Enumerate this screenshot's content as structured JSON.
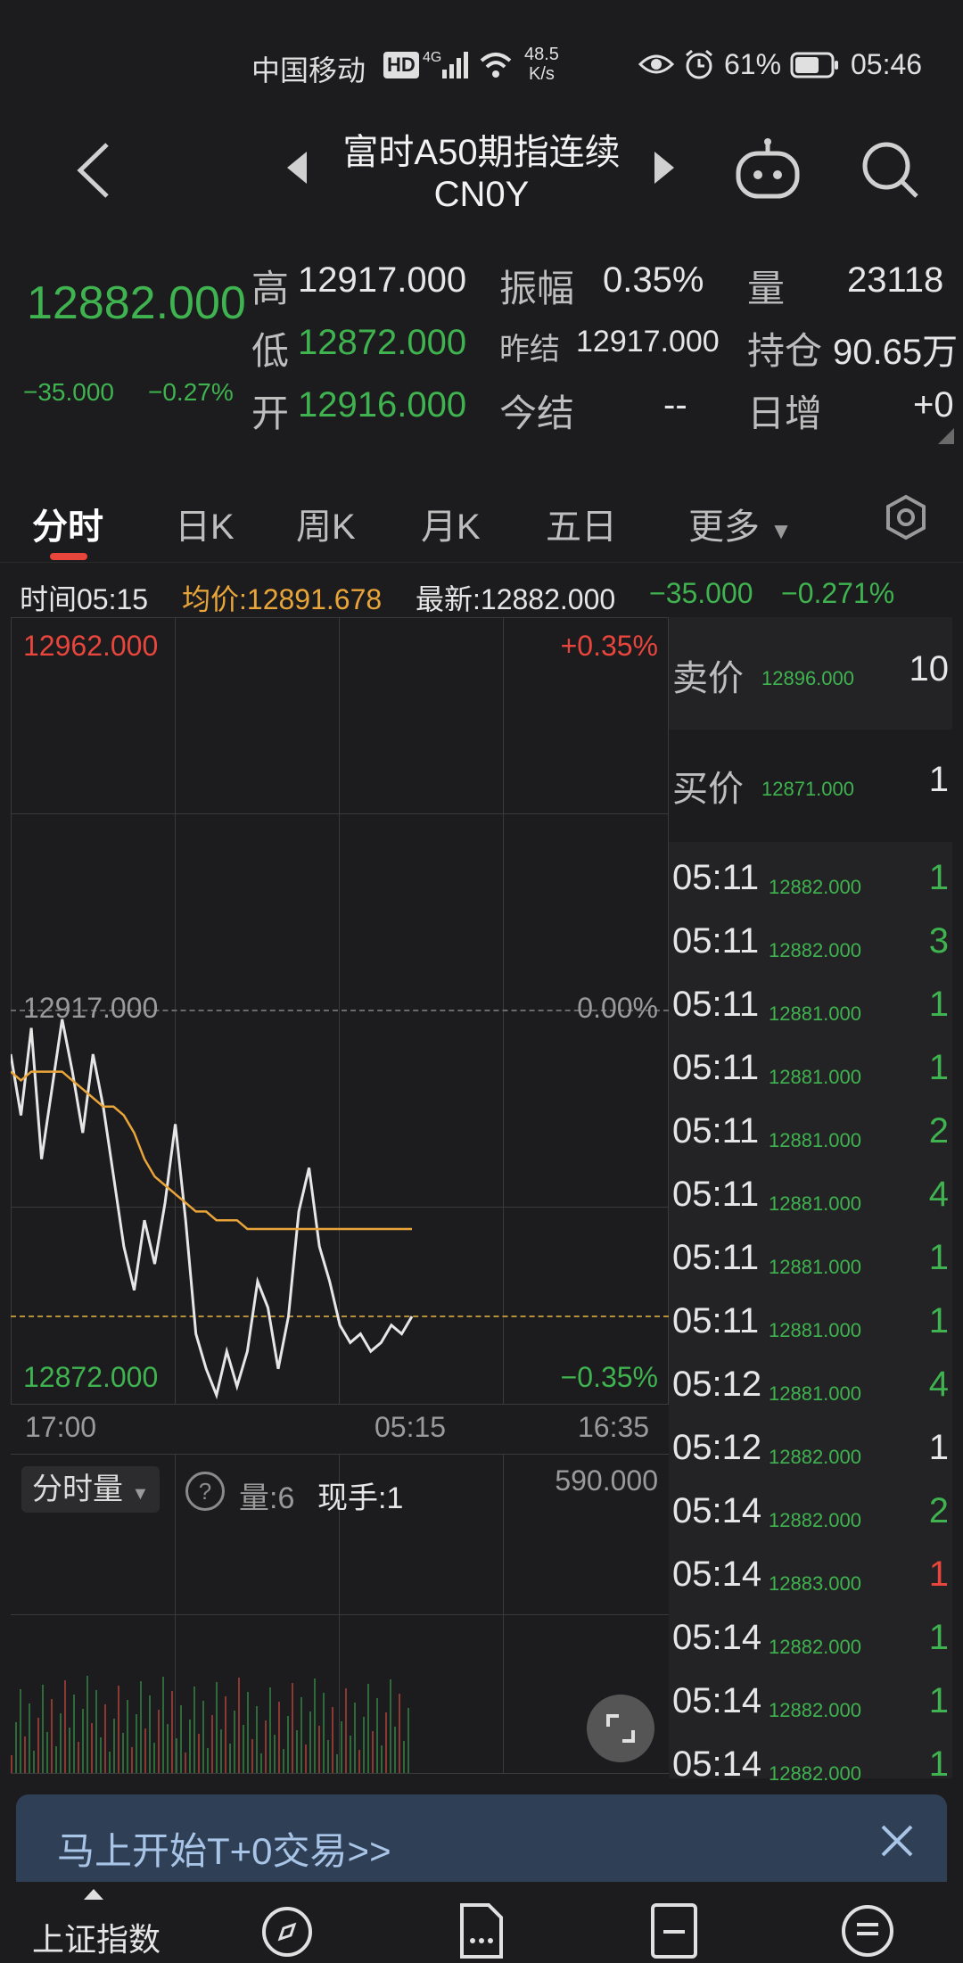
{
  "status_bar": {
    "carrier": "中国移动",
    "hd": "HD",
    "network": "4G",
    "speed_value": "48.5",
    "speed_unit": "K/s",
    "battery": "61%",
    "time": "05:46"
  },
  "header": {
    "title": "富时A50期指连续",
    "code": "CN0Y"
  },
  "quote": {
    "price": "12882.000",
    "change": "−35.000",
    "change_pct": "−0.27%",
    "high_label": "高",
    "high": "12917.000",
    "low_label": "低",
    "low": "12872.000",
    "open_label": "开",
    "open": "12916.000",
    "amplitude_label": "振幅",
    "amplitude": "0.35%",
    "prev_settle_label": "昨结",
    "prev_settle": "12917.000",
    "settle_label": "今结",
    "settle": "--",
    "volume_label": "量",
    "volume": "23118",
    "oi_label": "持仓",
    "oi": "90.65万",
    "daily_inc_label": "日增",
    "daily_inc": "+0"
  },
  "tabs": [
    {
      "label": "分时"
    },
    {
      "label": "日K"
    },
    {
      "label": "周K"
    },
    {
      "label": "月K"
    },
    {
      "label": "五日"
    },
    {
      "label": "更多"
    }
  ],
  "info_line": {
    "time": "时间05:15",
    "avg": "均价:12891.678",
    "latest": "最新:12882.000",
    "change": "−35.000",
    "change_pct": "−0.271%"
  },
  "chart": {
    "top_price": "12962.000",
    "top_pct": "+0.35%",
    "mid_price": "12917.000",
    "mid_pct": "0.00%",
    "bottom_price": "12872.000",
    "bottom_pct": "−0.35%",
    "x_start": "17:00",
    "x_mid": "05:15",
    "x_end": "16:35"
  },
  "chart_data": {
    "type": "line",
    "title": "",
    "xlabel": "",
    "ylabel": "",
    "ylim": [
      12872,
      12962
    ],
    "x_ticks": [
      "17:00",
      "05:15",
      "16:35"
    ],
    "series": [
      {
        "name": "最新",
        "color": "#e6e6e6",
        "values": [
          12912,
          12905,
          12915,
          12900,
          12908,
          12916,
          12910,
          12903,
          12912,
          12906,
          12898,
          12890,
          12885,
          12893,
          12888,
          12895,
          12904,
          12893,
          12880,
          12876,
          12873,
          12878,
          12874,
          12878,
          12886,
          12883,
          12876,
          12882,
          12894,
          12899,
          12890,
          12886,
          12881,
          12879,
          12880,
          12878,
          12879,
          12881,
          12880,
          12882
        ]
      },
      {
        "name": "均价",
        "color": "#e9a53a",
        "values": [
          12910,
          12909,
          12910,
          12910,
          12910,
          12910,
          12909,
          12908,
          12907,
          12906,
          12906,
          12905,
          12903,
          12900,
          12898,
          12897,
          12896,
          12895,
          12894,
          12894,
          12893,
          12893,
          12893,
          12892,
          12892,
          12892,
          12892,
          12892,
          12892,
          12892,
          12892,
          12892,
          12892,
          12892,
          12892,
          12892,
          12892,
          12892,
          12892,
          12892
        ]
      }
    ]
  },
  "book": {
    "sell_label": "卖价",
    "sell_price": "12896.000",
    "sell_qty": "10",
    "buy_label": "买价",
    "buy_price": "12871.000",
    "buy_qty": "1",
    "ticks": [
      {
        "time": "05:11",
        "price": "12882.000",
        "qty": "1",
        "dir": "green"
      },
      {
        "time": "05:11",
        "price": "12882.000",
        "qty": "3",
        "dir": "green"
      },
      {
        "time": "05:11",
        "price": "12881.000",
        "qty": "1",
        "dir": "green"
      },
      {
        "time": "05:11",
        "price": "12881.000",
        "qty": "1",
        "dir": "green"
      },
      {
        "time": "05:11",
        "price": "12881.000",
        "qty": "2",
        "dir": "green"
      },
      {
        "time": "05:11",
        "price": "12881.000",
        "qty": "4",
        "dir": "green"
      },
      {
        "time": "05:11",
        "price": "12881.000",
        "qty": "1",
        "dir": "green"
      },
      {
        "time": "05:11",
        "price": "12881.000",
        "qty": "1",
        "dir": "green"
      },
      {
        "time": "05:12",
        "price": "12881.000",
        "qty": "4",
        "dir": "green"
      },
      {
        "time": "05:12",
        "price": "12882.000",
        "qty": "1",
        "dir": "white"
      },
      {
        "time": "05:14",
        "price": "12882.000",
        "qty": "2",
        "dir": "green"
      },
      {
        "time": "05:14",
        "price": "12883.000",
        "qty": "1",
        "dir": "red"
      },
      {
        "time": "05:14",
        "price": "12882.000",
        "qty": "1",
        "dir": "green"
      },
      {
        "time": "05:14",
        "price": "12882.000",
        "qty": "1",
        "dir": "green"
      },
      {
        "time": "05:14",
        "price": "12882.000",
        "qty": "1",
        "dir": "green"
      }
    ]
  },
  "volume": {
    "selector_label": "分时量",
    "help": "?",
    "vol_text": "量:6",
    "hand_text": "现手:1",
    "max": "590.000"
  },
  "banner": {
    "text": "马上开始T+0交易>>"
  },
  "bottom_nav": {
    "item1": "上证指数"
  },
  "colors": {
    "up": "#e8453c",
    "down": "#3fb34f",
    "avg_line": "#e9a53a",
    "background": "#1c1c1e"
  }
}
